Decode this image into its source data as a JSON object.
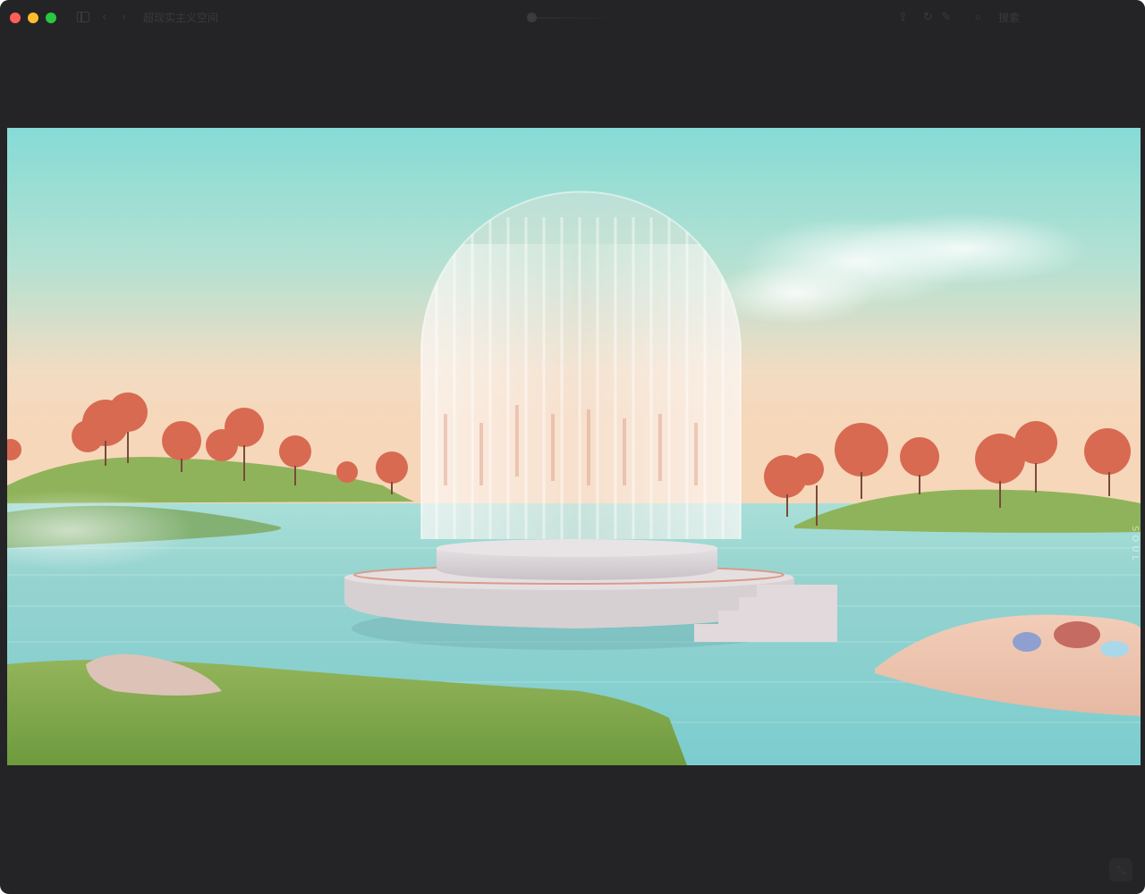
{
  "window": {
    "title": "超现实主义空间",
    "search_label": "搜索"
  },
  "toolbar": {
    "icons": [
      "sidebar-icon",
      "back-icon",
      "forward-icon",
      "share-icon",
      "rotate-icon",
      "markup-icon",
      "crop-icon",
      "search-icon"
    ]
  },
  "image": {
    "subject": "surreal-pedestal-scene",
    "watermark_text": "SOUL",
    "palette": {
      "sky_top": "#8fdcd6",
      "sky_bottom": "#f3d9bf",
      "water": "#8ed2cf",
      "tree": "#d86a52",
      "grass": "#7ea84a",
      "stone": "#d8d2d4"
    }
  }
}
